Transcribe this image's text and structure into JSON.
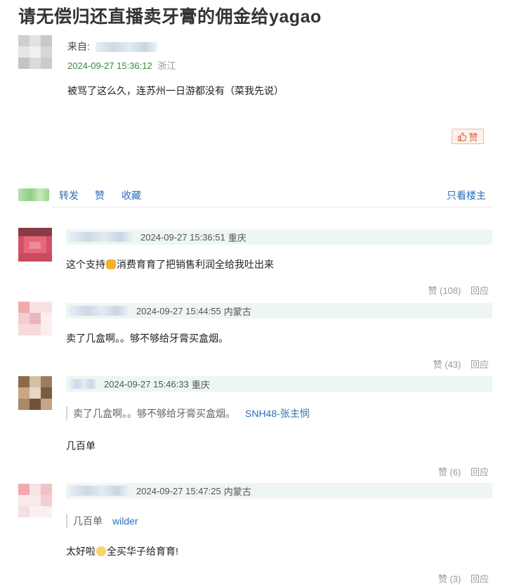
{
  "post": {
    "title": "请无偿归还直播卖牙膏的佣金给yagao",
    "from_label": "来自:",
    "time": "2024-09-27 15:36:12",
    "location": "浙江",
    "body": "被骂了这么久，连苏州一日游都没有（菜我先说）",
    "like_label": "赞"
  },
  "actions": {
    "forward": "转发",
    "like": "赞",
    "favorite": "收藏",
    "op_only": "只看楼主"
  },
  "comments": [
    {
      "time": "2024-09-27 15:36:51",
      "location": "重庆",
      "text_before": "这个支持",
      "text_after": "消费育育了把销售利润全给我吐出来",
      "emoji": "fist-emoji",
      "like_label": "赞 (108)",
      "reply_label": "回应"
    },
    {
      "time": "2024-09-27 15:44:55",
      "location": "内蒙古",
      "text": "卖了几盒啊。。够不够给牙膏买盒烟。",
      "like_label": "赞 (43)",
      "reply_label": "回应"
    },
    {
      "time": "2024-09-27 15:46:33",
      "location": "重庆",
      "quote_text": "卖了几盒啊。。够不够给牙膏买盒烟。",
      "quote_author": "SNH48-张主悯",
      "text": "几百单",
      "like_label": "赞 (6)",
      "reply_label": "回应"
    },
    {
      "time": "2024-09-27 15:47:25",
      "location": "内蒙古",
      "quote_text": "几百单",
      "quote_author": "wilder",
      "text_before": "太好啦",
      "text_after": "全买华子给育育!",
      "emoji": "blush-emoji",
      "like_label": "赞 (3)",
      "reply_label": "回应"
    }
  ],
  "colors": {
    "link": "#2a6ebb",
    "post_time": "#3a8a3a",
    "meta_bg": "#eef6f1",
    "like_accent": "#e2673d"
  }
}
